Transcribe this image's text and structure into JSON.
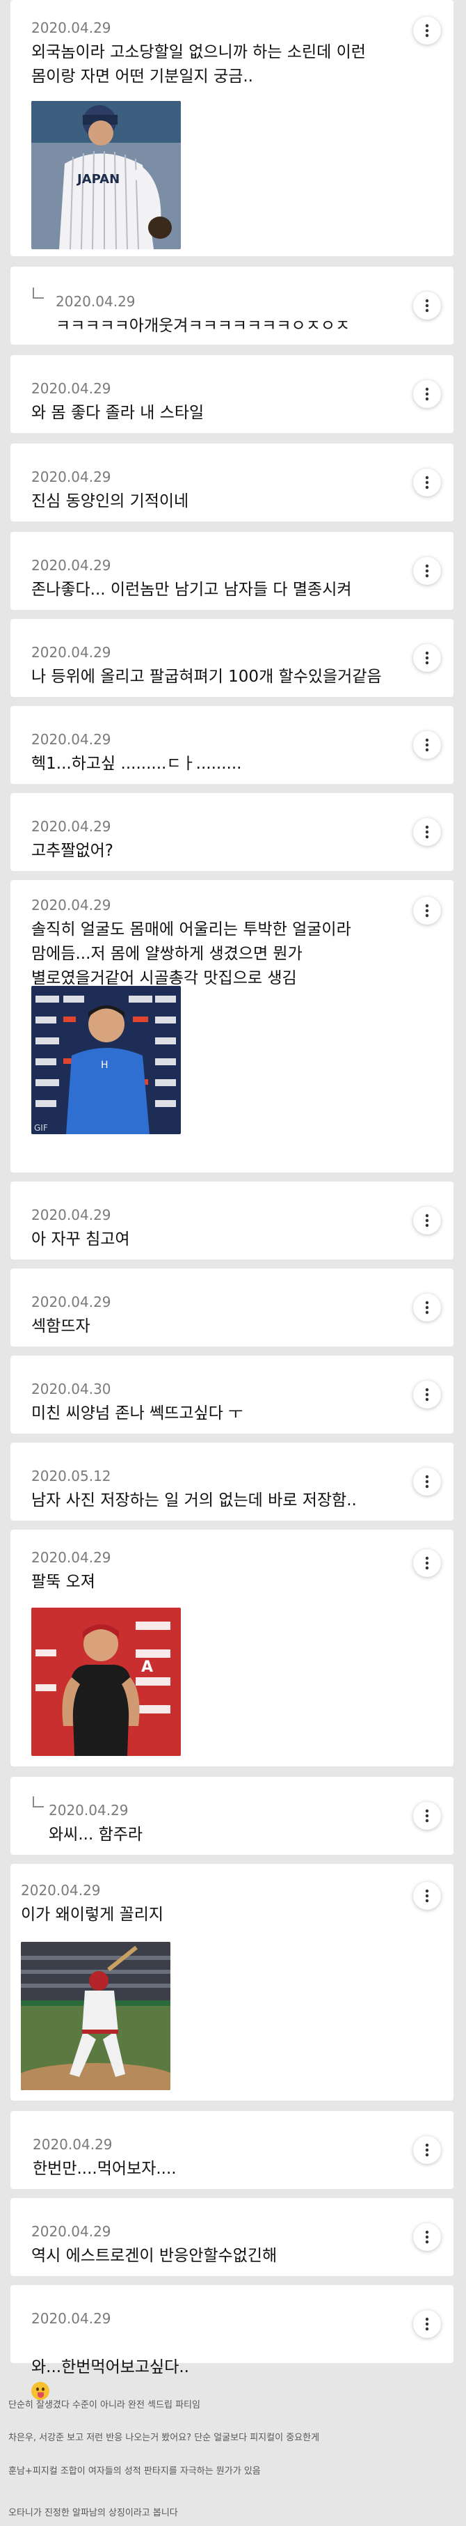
{
  "comments": [
    {
      "date": "2020.04.29",
      "text": "외국놈이라 고소당할일 없으니까 하는 소린데 이런\n몸이랑 자면 어떤 기분일지 궁금..",
      "image": "baseball-player-japan-uniform"
    },
    {
      "date": "2020.04.29",
      "text": "ㅋㅋㅋㅋㅋ아개웃겨ㅋㅋㅋㅋㅋㅋㅋㅇㅈㅇㅈ",
      "reply": true
    },
    {
      "date": "2020.04.29",
      "text": "와 몸 좋다 졸라 내 스타일"
    },
    {
      "date": "2020.04.29",
      "text": "진심 동양인의 기적이네"
    },
    {
      "date": "2020.04.29",
      "text": "존나좋다... 이런놈만 남기고 남자들 다 멸종시켜"
    },
    {
      "date": "2020.04.29",
      "text": "나 등위에 올리고 팔굽혀펴기 100개 할수있을거같음"
    },
    {
      "date": "2020.04.29",
      "text": "헥1...하고싶 .........ㄷㅏ........."
    },
    {
      "date": "2020.04.29",
      "text": "고추짤없어?"
    },
    {
      "date": "2020.04.29",
      "text": "솔직히 얼굴도 몸매에 어울리는 투박한 얼굴이라\n맘에듬...저 몸에 얄쌍하게 생겼으면 뭔가\n별로였을거같어 시골총각 맛집으로 생김",
      "image": "player-blue-jersey-interview"
    },
    {
      "date": "2020.04.29",
      "text": "아 자꾸 침고여"
    },
    {
      "date": "2020.04.29",
      "text": "섹함뜨자"
    },
    {
      "date": "2020.04.30",
      "text": "미친 씨양넘 존나 쎅뜨고싶다 ㅜ"
    },
    {
      "date": "2020.05.12",
      "text": "남자 사진 저장하는 일 거의 없는데 바로 저장함.."
    },
    {
      "date": "2020.04.29",
      "text": "팔뚝 오져",
      "image": "player-black-sleeveless"
    },
    {
      "date": "2020.04.29",
      "text": "와씨... 함주라",
      "reply": true
    },
    {
      "date": "2020.04.29",
      "text": "이가 왜이렇게 꼴리지",
      "image": "player-batting-stadium"
    },
    {
      "date": "2020.04.29",
      "text": "한번만....먹어보자...."
    },
    {
      "date": "2020.04.29",
      "text": "역시 에스트로겐이 반응안할수없긴해"
    },
    {
      "date": "2020.04.29",
      "text": "와...한번먹어보고싶다..",
      "emoji": "tongue-out-face"
    }
  ],
  "footer": [
    "단순히 잘생겼다 수준이 아니라 완전 섹드립 파티임",
    "차은우, 서강준 보고 저런 반응 나오는거 봤어요? 단순 얼굴보다 피지컬이 중요한게",
    "훈남+피지컬 조합이 여자들의 성적 판타지를 자극하는 뭔가가 있음",
    "오타니가 진정한 알파남의 상징이라고 봅니다"
  ],
  "icons": {
    "more": "more-vertical-icon",
    "reply": "reply-arrow-icon"
  },
  "colors": {
    "background": "#e6e6e6",
    "card": "#ffffff",
    "date": "#7a7a7a"
  }
}
